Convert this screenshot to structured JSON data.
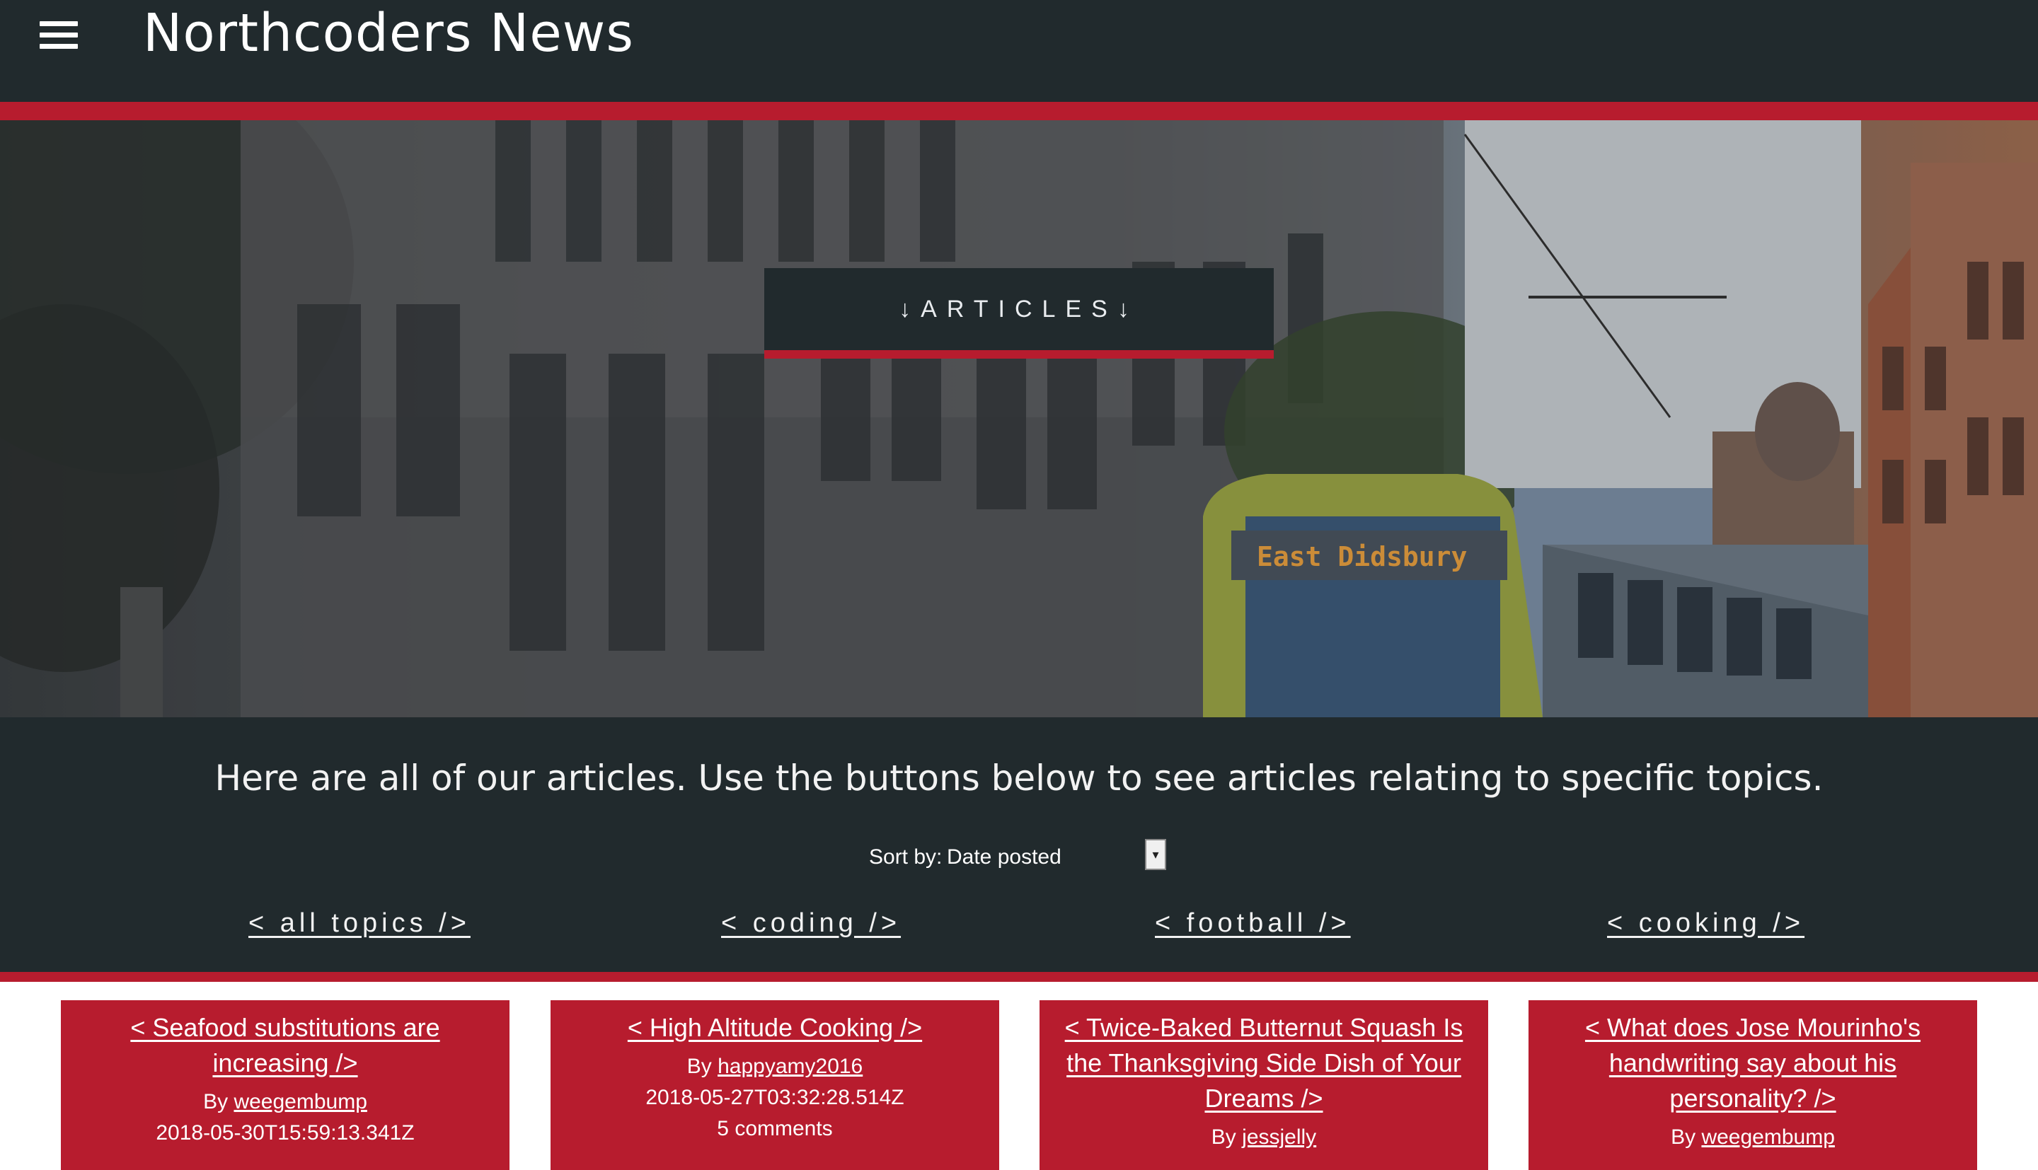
{
  "header": {
    "title": "Northcoders News",
    "menu_icon": "hamburger-menu-icon"
  },
  "hero": {
    "button_label": "↓ARTICLES↓",
    "tram_sign": "East Didsbury"
  },
  "intro": {
    "text": "Here are all of our articles. Use the buttons below to see articles relating to specific topics.",
    "sort_label": "Sort by:",
    "sort_value": "Date posted"
  },
  "topics": [
    "< all topics />",
    "< coding />",
    "< football />",
    "< cooking />"
  ],
  "colors": {
    "dark": "#212a2d",
    "accent_red": "#b71c2e"
  },
  "articles": [
    {
      "title": "< Seafood substitutions are increasing />",
      "by_label": "By",
      "author": "weegembump",
      "date": "2018-05-30T15:59:13.341Z"
    },
    {
      "title": "< High Altitude Cooking />",
      "by_label": "By",
      "author": "happyamy2016",
      "date": "2018-05-27T03:32:28.514Z",
      "comments": "5 comments"
    },
    {
      "title": "< Twice-Baked Butternut Squash Is the Thanksgiving Side Dish of Your Dreams />",
      "by_label": "By",
      "author": "jessjelly"
    },
    {
      "title": "< What does Jose Mourinho's handwriting say about his personality? />",
      "by_label": "By",
      "author": "weegembump"
    }
  ]
}
